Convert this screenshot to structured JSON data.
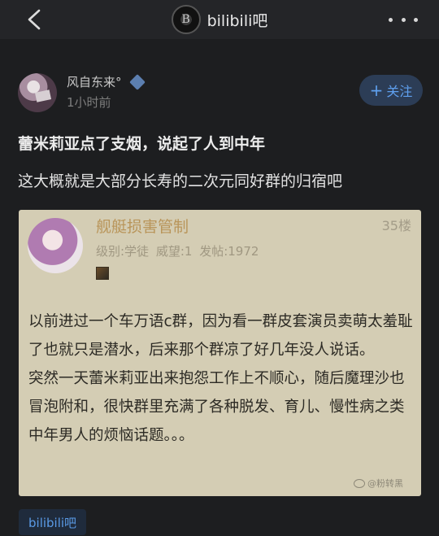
{
  "header": {
    "back_icon": "chevron-left-icon",
    "logo_text": "B",
    "forum_name": "bilibili吧",
    "more_icon": "more-horizontal-icon"
  },
  "author": {
    "name": "风自东来°",
    "badge_icon": "diamond-badge-icon",
    "time": "1小时前",
    "follow_label": "关注",
    "follow_icon": "+"
  },
  "post": {
    "title": "蕾米莉亚点了支烟，说起了人到中年",
    "body": "这大概就是大部分长寿的二次元同好群的归宿吧"
  },
  "embedded": {
    "username": "舰艇损害管制",
    "floor": "35楼",
    "meta": "级别:学徒  威望:1  发帖:1972",
    "paragraphs": [
      "以前进过一个车万语c群，因为看一群皮套演员卖萌太羞耻了也就只是潜水，后来那个群凉了好几年没人说话。",
      "突然一天蕾米莉亚出来抱怨工作上不顺心，随后魔理沙也冒泡附和，很快群里充满了各种脱发、育儿、慢性病之类中年男人的烦恼话题。。。"
    ],
    "watermark": "@粉转黑"
  },
  "tag": {
    "label": "bilibili吧"
  },
  "colors": {
    "background": "#1d1e20",
    "topbar": "#242528",
    "follow_bg": "#2c3d56",
    "follow_text": "#5fa0ef",
    "embedded_bg": "#d4cdb4",
    "username": "#b9955a"
  }
}
